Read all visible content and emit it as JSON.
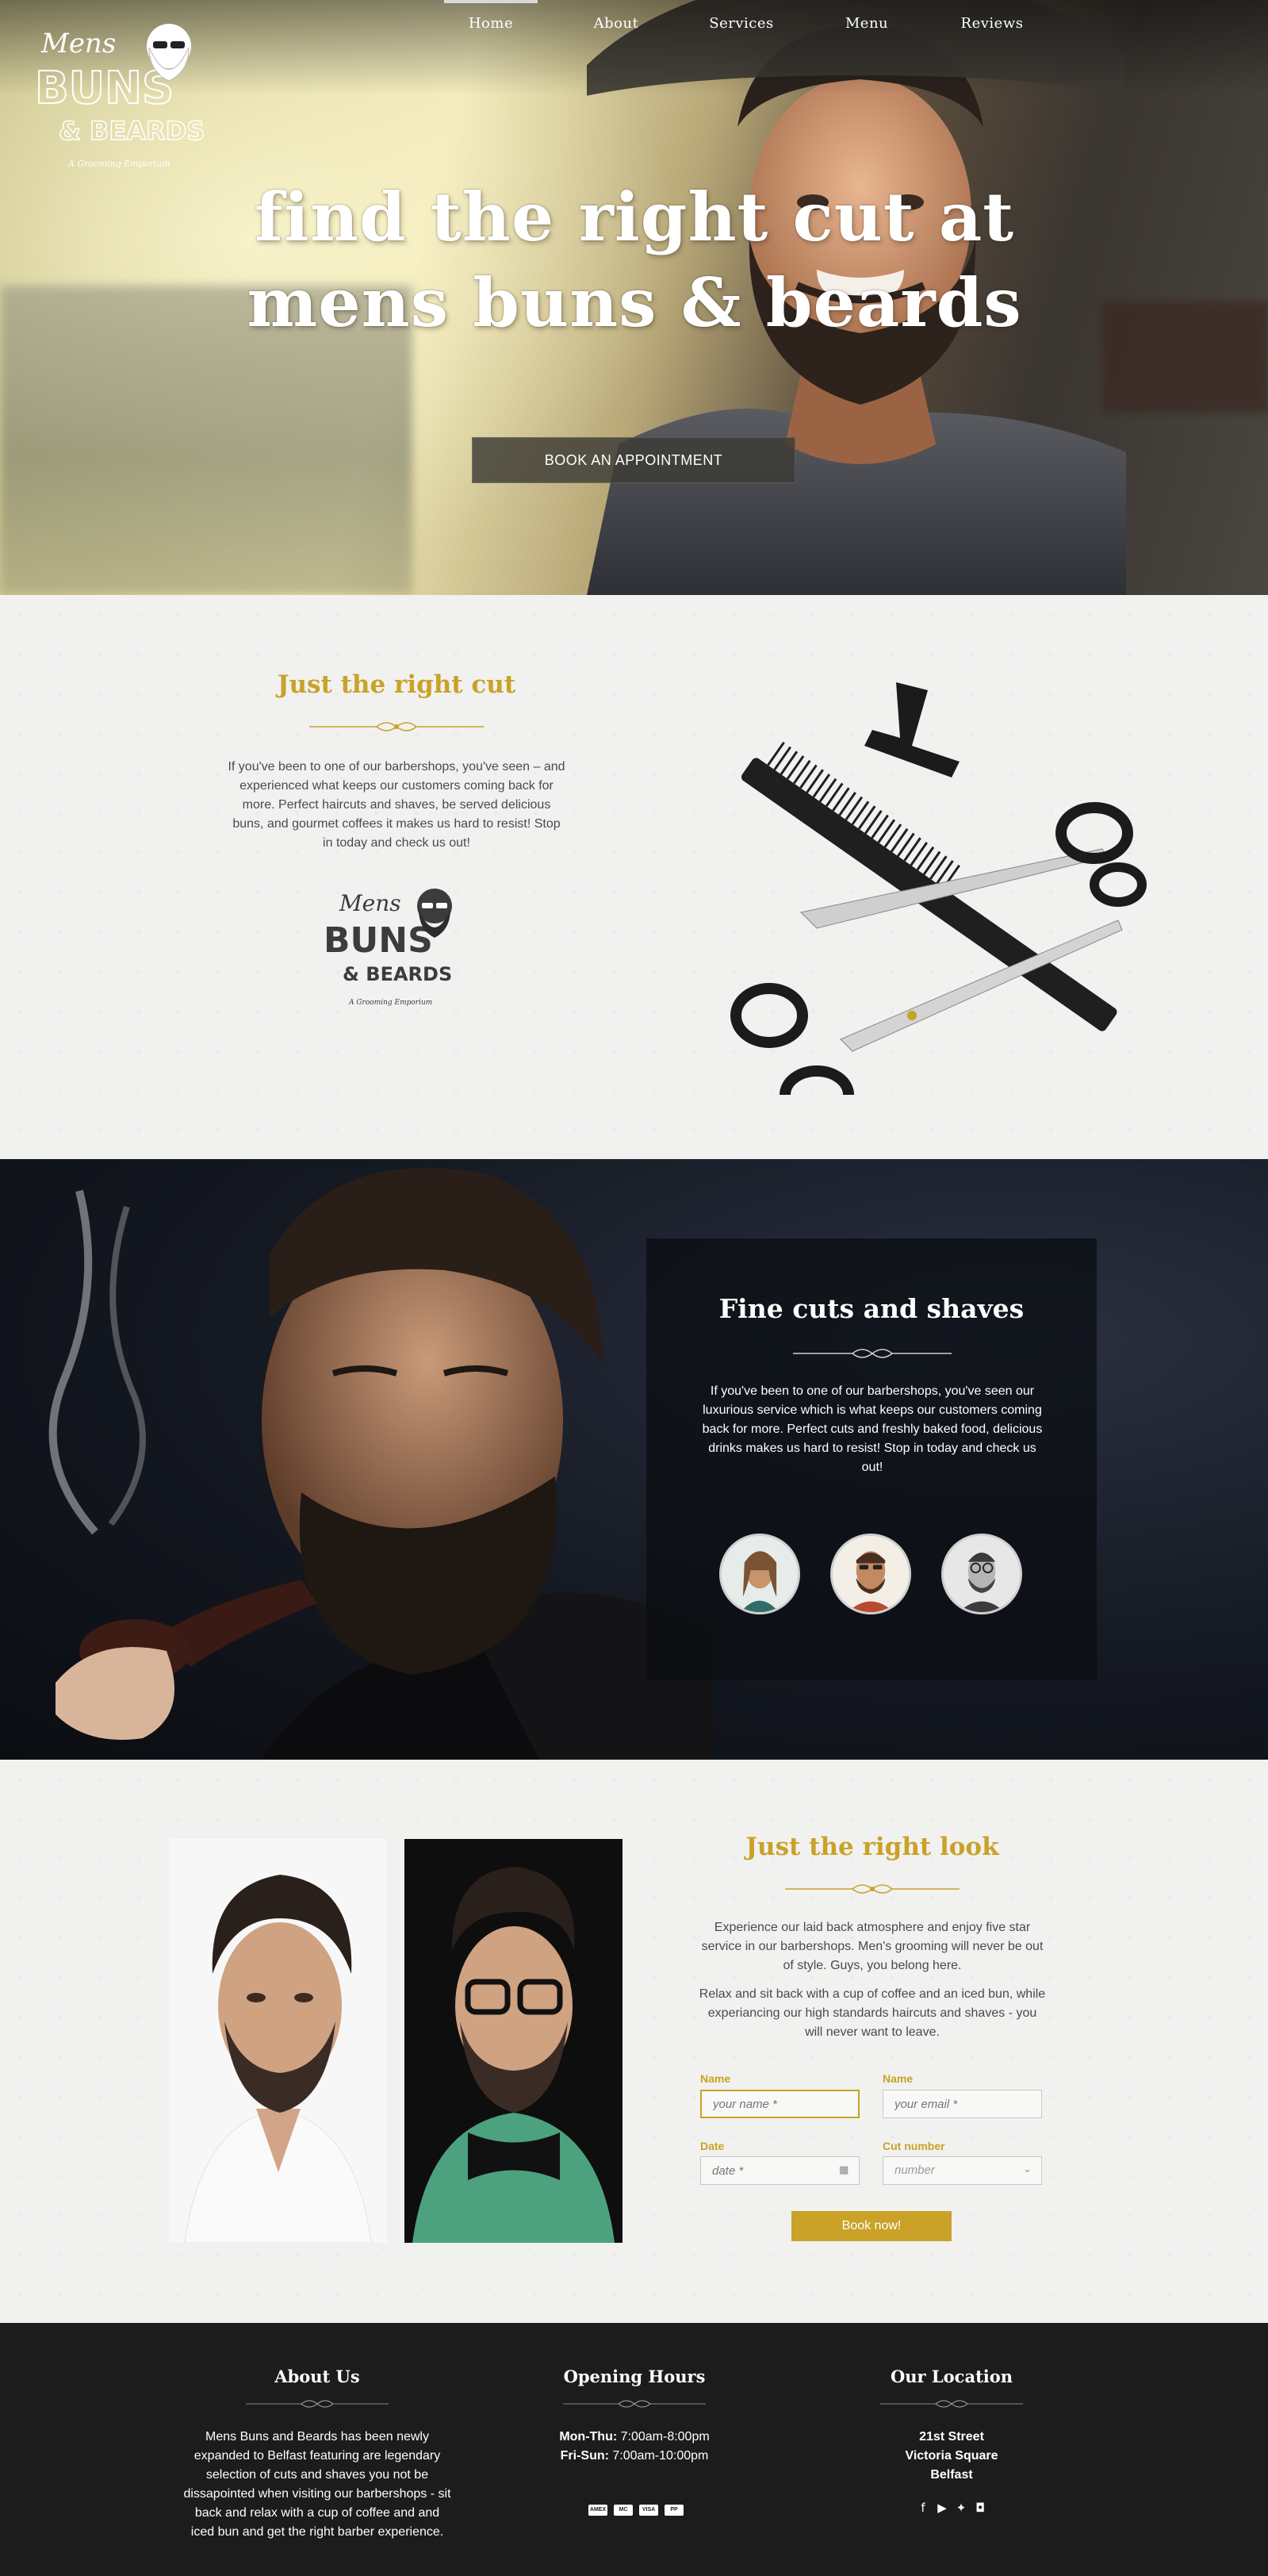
{
  "brand": {
    "line1": "Mens",
    "line2": "BUNS",
    "line3": "& BEARDS",
    "tagline": "A Grooming Emporium"
  },
  "nav": {
    "items": [
      {
        "label": "Home",
        "active": true
      },
      {
        "label": "About",
        "active": false
      },
      {
        "label": "Services",
        "active": false
      },
      {
        "label": "Menu",
        "active": false
      },
      {
        "label": "Reviews",
        "active": false
      }
    ]
  },
  "hero": {
    "title_line1": "find the right cut at",
    "title_line2": "mens buns & beards",
    "cta": "BOOK AN APPOINTMENT"
  },
  "right_cut": {
    "heading": "Just the right cut",
    "body": "If you've been to one of our barbershops, you've seen – and experienced what keeps our customers coming back for more. Perfect haircuts and shaves, be served delicious buns, and gourmet coffees it makes us hard to resist! Stop in today and check us out!"
  },
  "fine_cuts": {
    "heading": "Fine cuts and shaves",
    "body": "If you've been to one of our barbershops, you've seen our luxurious service which is what keeps our customers coming back for more. Perfect cuts and freshly baked food, delicious drinks makes us hard to resist! Stop in today and check us out!"
  },
  "right_look": {
    "heading": "Just the right look",
    "para1": "Experience our laid back atmosphere and enjoy five star service in our barbershops. Men's grooming will never be out of style. Guys, you belong here.",
    "para2": "Relax and sit back with a cup of coffee and an iced bun, while experiancing our high standards haircuts and shaves - you will never want to leave."
  },
  "form": {
    "name_label": "Name",
    "name_placeholder": "your name *",
    "email_label": "Name",
    "email_placeholder": "your email *",
    "date_label": "Date",
    "date_placeholder": "date *",
    "cut_label": "Cut number",
    "cut_value": "number",
    "submit": "Book now!"
  },
  "footer": {
    "about_title": "About Us",
    "about_text": "Mens Buns and Beards has been newly expanded to Belfast featuring are legendary selection of cuts and shaves you not be dissapointed when visiting our barbershops - sit back and relax with a cup of coffee and and iced bun and get the right barber experience.",
    "hours_title": "Opening Hours",
    "hours": [
      {
        "days": "Mon-Thu:",
        "time": " 7:00am-8:00pm"
      },
      {
        "days": "Fri-Sun:",
        "time": " 7:00am-10:00pm"
      }
    ],
    "payments": [
      "AMEX",
      "MC",
      "VISA",
      "PP"
    ],
    "location_title": "Our Location",
    "address": [
      "21st Street",
      "Victoria Square",
      "Belfast"
    ],
    "social_icons": [
      "facebook-icon",
      "youtube-icon",
      "twitter-icon",
      "instagram-icon"
    ]
  },
  "colors": {
    "gold": "#c9a227",
    "dark": "#1c1c1c",
    "light_bg": "#f1f1f0"
  }
}
